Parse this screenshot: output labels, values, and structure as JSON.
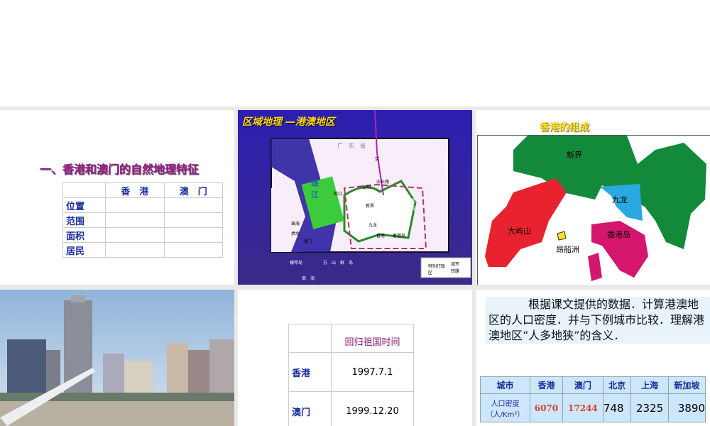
{
  "slide1": {
    "title": "一、香港和澳门的自然地理特征",
    "header": [
      "",
      "香　港",
      "澳　门"
    ],
    "rows": [
      "位置",
      "范围",
      "面积",
      "居民"
    ]
  },
  "slide2": {
    "title": "区域地理 —港澳地区",
    "labels": {
      "guangdong": "广　东　省",
      "zhujiang": "珠江",
      "jing": "京",
      "shenzhen": "深圳",
      "shatoujiao": "沙头角",
      "shekou": "蛇口",
      "xinjie": "新界",
      "kowloon": "九龙",
      "hongkong": "香港",
      "hkisland": "香港岛",
      "zhuhai": "珠海",
      "gongbei": "拱北",
      "macau": "澳门",
      "hengqin": "横琴岛",
      "dayawan": "大亚湾",
      "dapengwan": "大鹏湾",
      "wanshan": "万　山　群　岛",
      "nanhai": "南　海"
    },
    "legend": [
      "特别行政区",
      "城市",
      "铁路"
    ]
  },
  "slide3": {
    "title": "香港的组成",
    "regions": [
      "新界",
      "九龙",
      "大屿山",
      "香港岛",
      "昂船洲"
    ]
  },
  "slide5": {
    "header": "回归祖国时间",
    "rows": [
      {
        "name": "香港",
        "date": "1997.7.1"
      },
      {
        "name": "澳门",
        "date": "1999.12.20"
      }
    ]
  },
  "slide6": {
    "text": "根据课文提供的数据．计算港澳地区的人口密度．并与下例城市比较．理解港澳地区“人多地狭”的含义．",
    "header": [
      "城市",
      "香港",
      "澳门",
      "北京",
      "上海",
      "新加坡"
    ],
    "rowLabel": "人口密度（人/Km²）",
    "values": [
      "6070",
      "17244",
      "748",
      "2325",
      "3890"
    ]
  }
}
